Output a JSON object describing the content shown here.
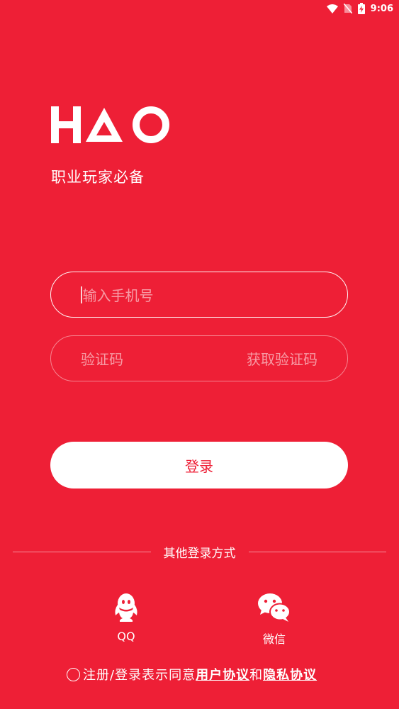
{
  "status_bar": {
    "time": "9:06"
  },
  "brand": {
    "logo_text": "HAO",
    "tagline": "职业玩家必备"
  },
  "form": {
    "phone_placeholder": "输入手机号",
    "code_placeholder": "验证码",
    "get_code_label": "获取验证码",
    "login_label": "登录"
  },
  "other_login": {
    "title": "其他登录方式",
    "options": [
      {
        "label": "QQ",
        "icon": "qq-icon"
      },
      {
        "label": "微信",
        "icon": "wechat-icon"
      }
    ]
  },
  "agreement": {
    "prefix": "注册/登录表示同意",
    "user_agreement": "用户协议",
    "joiner": "和",
    "privacy_agreement": "隐私协议"
  },
  "colors": {
    "background": "#ee1f36",
    "foreground": "#ffffff"
  }
}
